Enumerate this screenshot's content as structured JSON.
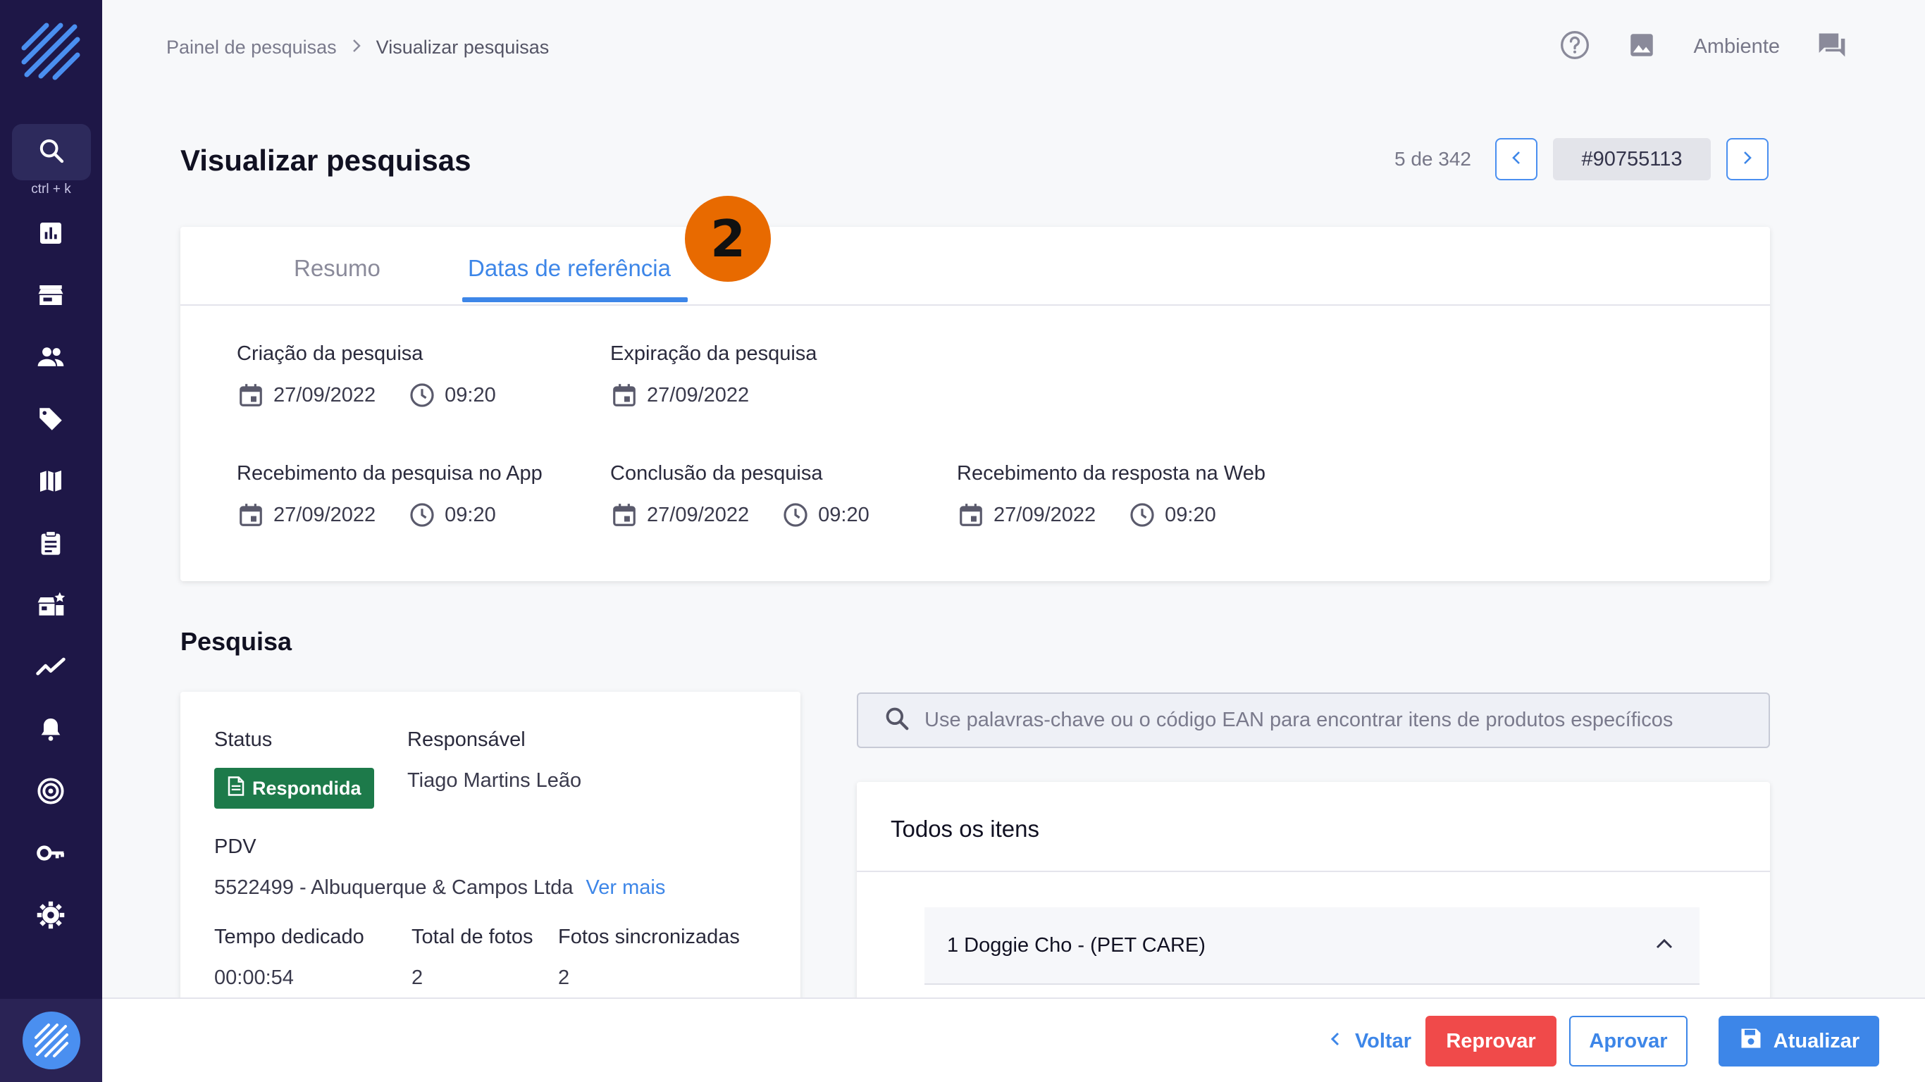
{
  "sidebar": {
    "shortcut": "ctrl + k",
    "icons": [
      "search-icon",
      "dashboard-icon",
      "store-icon",
      "people-icon",
      "tag-icon",
      "map-icon",
      "clipboard-icon",
      "store-star-icon",
      "trending-icon",
      "bell-icon",
      "target-icon",
      "key-icon",
      "gear-icon"
    ]
  },
  "breadcrumb": {
    "parent": "Painel de pesquisas",
    "current": "Visualizar pesquisas"
  },
  "header": {
    "environment": "Ambiente"
  },
  "page": {
    "title": "Visualizar pesquisas"
  },
  "pager": {
    "count": "5 de 342",
    "code": "#90755113"
  },
  "tabs": {
    "resumo": "Resumo",
    "datas": "Datas de referência"
  },
  "step_marker": "2",
  "reference_dates": {
    "criacao": {
      "label": "Criação da pesquisa",
      "date": "27/09/2022",
      "time": "09:20"
    },
    "expiracao": {
      "label": "Expiração da pesquisa",
      "date": "27/09/2022"
    },
    "recebimento_app": {
      "label": "Recebimento da pesquisa no App",
      "date": "27/09/2022",
      "time": "09:20"
    },
    "conclusao": {
      "label": "Conclusão da pesquisa",
      "date": "27/09/2022",
      "time": "09:20"
    },
    "recebimento_web": {
      "label": "Recebimento da resposta na Web",
      "date": "27/09/2022",
      "time": "09:20"
    }
  },
  "pesquisa": {
    "title": "Pesquisa",
    "status_label": "Status",
    "status_value": "Respondida",
    "responsavel_label": "Responsável",
    "responsavel_value": "Tiago Martins Leão",
    "pdv_label": "PDV",
    "pdv_value": "5522499 - Albuquerque & Campos Ltda",
    "ver_mais": "Ver mais",
    "tempo_label": "Tempo dedicado",
    "tempo_value": "00:00:54",
    "total_fotos_label": "Total de fotos",
    "total_fotos_value": "2",
    "fotos_sync_label": "Fotos sincronizadas",
    "fotos_sync_value": "2"
  },
  "search": {
    "placeholder": "Use palavras-chave ou o código EAN para encontrar itens de produtos específicos"
  },
  "items": {
    "title": "Todos os itens",
    "first_item": "1 Doggie Cho - (PET CARE)"
  },
  "actions": {
    "voltar": "Voltar",
    "reprovar": "Reprovar",
    "aprovar": "Aprovar",
    "atualizar": "Atualizar"
  },
  "colors": {
    "sidebar": "#1e1747",
    "accent": "#3d86e8",
    "danger": "#f04a4a",
    "success": "#1d7a4a",
    "marker": "#e86a00"
  }
}
